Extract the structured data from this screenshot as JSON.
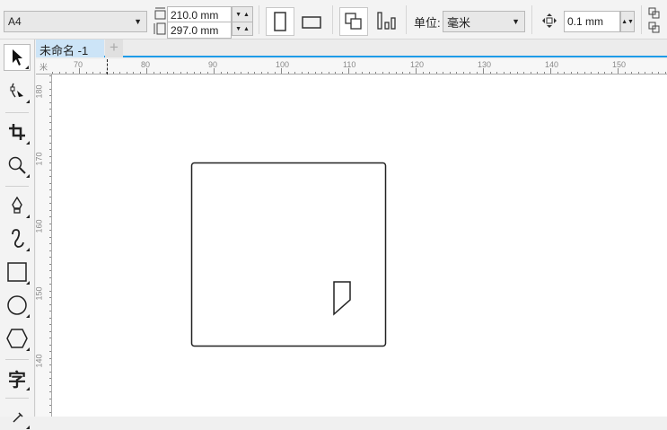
{
  "property_bar": {
    "page_size": "A4",
    "width": "210.0 mm",
    "height": "297.0 mm",
    "units_label": "单位:",
    "units_value": "毫米",
    "nudge": "0.1 mm"
  },
  "tabs": [
    {
      "label": "未命名 -1"
    }
  ],
  "add_tab": "+",
  "ruler": {
    "unit": "米",
    "horizontal": [
      "70",
      "80",
      "90",
      "100",
      "110",
      "120",
      "130",
      "140",
      "150"
    ],
    "vertical": [
      "180",
      "170",
      "160",
      "150",
      "140"
    ]
  },
  "tools": [
    "pick",
    "shape",
    "crop",
    "zoom",
    "pen",
    "artistic-media",
    "rectangle",
    "ellipse",
    "polygon",
    "text",
    "dimension"
  ],
  "text_tool_glyph": "字"
}
